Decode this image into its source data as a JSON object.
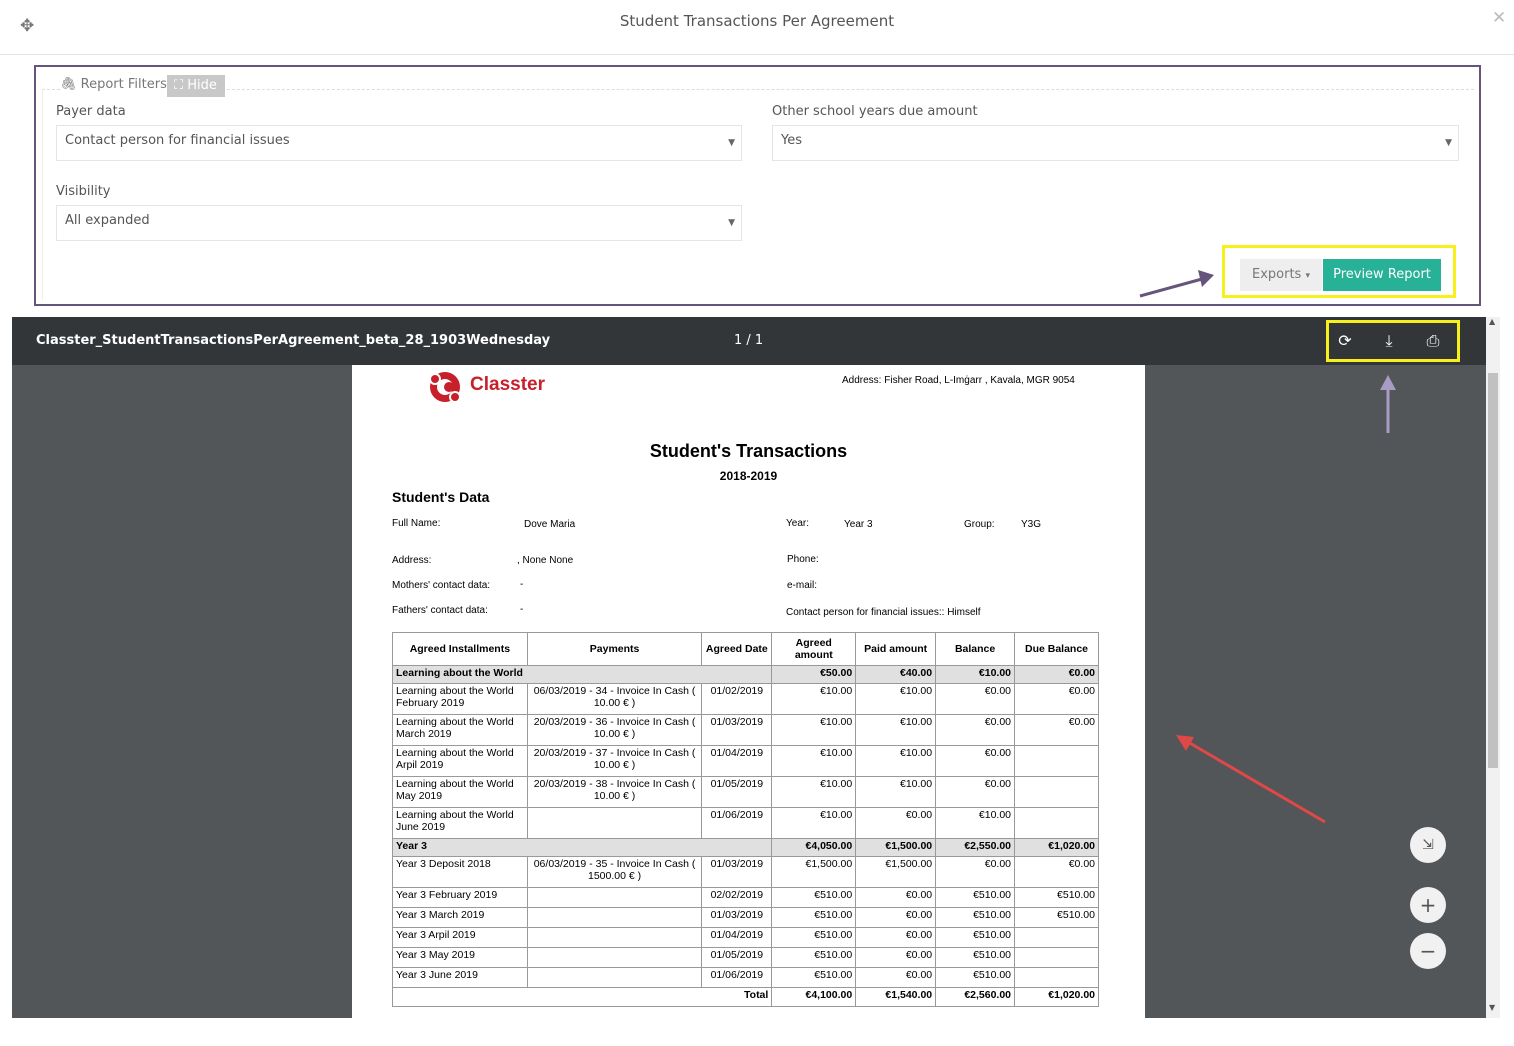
{
  "modal": {
    "title": "Student Transactions Per Agreement"
  },
  "filters": {
    "legend": "Report Filters",
    "hide_label": "Hide",
    "payer_label": "Payer data",
    "payer_value": "Contact person for financial issues",
    "other_label": "Other school years due amount",
    "other_value": "Yes",
    "visibility_label": "Visibility",
    "visibility_value": "All expanded",
    "exports_label": "Exports",
    "preview_label": "Preview Report"
  },
  "viewer": {
    "filename": "Classter_StudentTransactionsPerAgreement_beta_28_1903Wednesday",
    "pages": "1 / 1"
  },
  "report": {
    "logo_text": "Classter",
    "address": "Address: Fisher Road, L-Imġarr , Kavala, MGR 9054",
    "title": "Student's Transactions",
    "year": "2018-2019",
    "student_section": "Student's Data",
    "full_name_label": "Full Name:",
    "full_name": "Dove Maria",
    "year_label": "Year:",
    "year_value": "Year 3",
    "group_label": "Group:",
    "group_value": "Y3G",
    "address_label": "Address:",
    "address_value": ", None None",
    "phone_label": "Phone:",
    "mothers_label": "Mothers' contact data:",
    "mothers_value": "-",
    "email_label": "e-mail:",
    "fathers_label": "Fathers' contact data:",
    "fathers_value": "-",
    "contact_label": "Contact person for financial issues:: Himself",
    "columns": [
      "Agreed Installments",
      "Payments",
      "Agreed Date",
      "Agreed amount",
      "Paid amount",
      "Balance",
      "Due Balance"
    ],
    "groups": [
      {
        "name": "Learning about the World",
        "agreed": "€50.00",
        "paid": "€40.00",
        "balance": "€10.00",
        "due": "€0.00",
        "rows": [
          {
            "inst": "Learning about the World February 2019",
            "pay": "06/03/2019 - 34 -  Invoice In Cash ( 10.00 € )",
            "date": "01/02/2019",
            "agreed": "€10.00",
            "paid": "€10.00",
            "balance": "€0.00",
            "due": "€0.00"
          },
          {
            "inst": "Learning about the World March 2019",
            "pay": "20/03/2019 - 36 -  Invoice In Cash ( 10.00 € )",
            "date": "01/03/2019",
            "agreed": "€10.00",
            "paid": "€10.00",
            "balance": "€0.00",
            "due": "€0.00"
          },
          {
            "inst": "Learning about the World Arpil 2019",
            "pay": "20/03/2019 - 37 -  Invoice In Cash ( 10.00 € )",
            "date": "01/04/2019",
            "agreed": "€10.00",
            "paid": "€10.00",
            "balance": "€0.00",
            "due": ""
          },
          {
            "inst": "Learning about the World May 2019",
            "pay": "20/03/2019 - 38 -  Invoice In Cash ( 10.00 € )",
            "date": "01/05/2019",
            "agreed": "€10.00",
            "paid": "€10.00",
            "balance": "€0.00",
            "due": ""
          },
          {
            "inst": "Learning about the World June 2019",
            "pay": "",
            "date": "01/06/2019",
            "agreed": "€10.00",
            "paid": "€0.00",
            "balance": "€10.00",
            "due": ""
          }
        ]
      },
      {
        "name": "Year 3",
        "agreed": "€4,050.00",
        "paid": "€1,500.00",
        "balance": "€2,550.00",
        "due": "€1,020.00",
        "rows": [
          {
            "inst": "Year 3 Deposit 2018",
            "pay": "06/03/2019 - 35 -  Invoice In Cash ( 1500.00 € )",
            "date": "01/03/2019",
            "agreed": "€1,500.00",
            "paid": "€1,500.00",
            "balance": "€0.00",
            "due": "€0.00"
          },
          {
            "inst": "Year 3 February 2019",
            "pay": "",
            "date": "02/02/2019",
            "agreed": "€510.00",
            "paid": "€0.00",
            "balance": "€510.00",
            "due": "€510.00"
          },
          {
            "inst": "Year 3 March 2019",
            "pay": "",
            "date": "01/03/2019",
            "agreed": "€510.00",
            "paid": "€0.00",
            "balance": "€510.00",
            "due": "€510.00"
          },
          {
            "inst": "Year 3 Arpil 2019",
            "pay": "",
            "date": "01/04/2019",
            "agreed": "€510.00",
            "paid": "€0.00",
            "balance": "€510.00",
            "due": ""
          },
          {
            "inst": "Year 3 May 2019",
            "pay": "",
            "date": "01/05/2019",
            "agreed": "€510.00",
            "paid": "€0.00",
            "balance": "€510.00",
            "due": ""
          },
          {
            "inst": "Year 3 June 2019",
            "pay": "",
            "date": "01/06/2019",
            "agreed": "€510.00",
            "paid": "€0.00",
            "balance": "€510.00",
            "due": ""
          }
        ]
      }
    ],
    "total": {
      "label": "Total",
      "agreed": "€4,100.00",
      "paid": "€1,540.00",
      "balance": "€2,560.00",
      "due": "€1,020.00"
    }
  },
  "colors": {
    "accent": "#27b197",
    "highlight": "#f7f01c",
    "frame": "#65557d",
    "annotation_arrow": "#e04848",
    "logo": "#c8202a"
  }
}
